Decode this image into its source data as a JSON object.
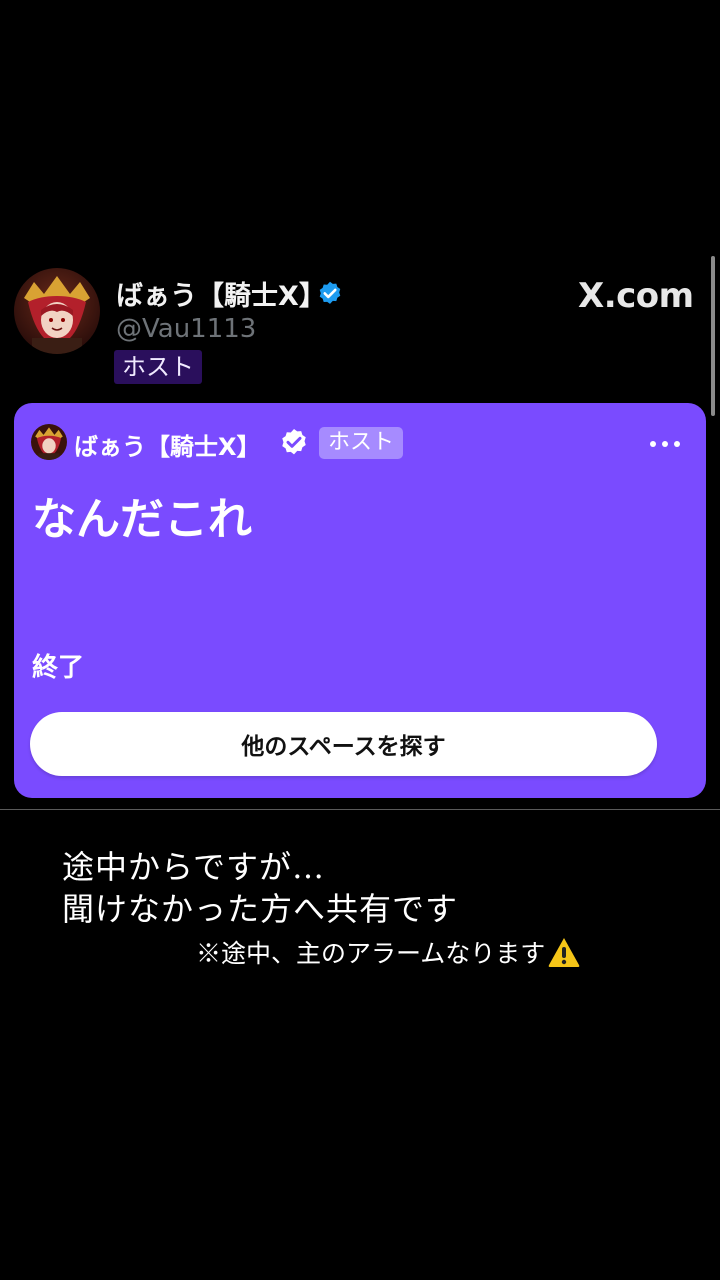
{
  "header": {
    "host_name": "ばぁう【騎士X】",
    "handle": "@Vau1113",
    "host_badge": "ホスト",
    "site": "X.com"
  },
  "space_card": {
    "host_name": "ばぁう【騎士X】",
    "host_badge": "ホスト",
    "title": "なんだこれ",
    "status": "終了",
    "explore_button": "他のスペースを探す",
    "background_color": "#7a4bff"
  },
  "caption": {
    "line1": "途中からですが…",
    "line2": "聞けなかった方へ共有です",
    "note": "※途中、主のアラームなります"
  },
  "icons": [
    "verified-badge-icon",
    "more-options-icon",
    "warning-icon"
  ],
  "colors": {
    "verified_blue": "#1d9bf0",
    "badge_dark": "#2a0f5c"
  }
}
